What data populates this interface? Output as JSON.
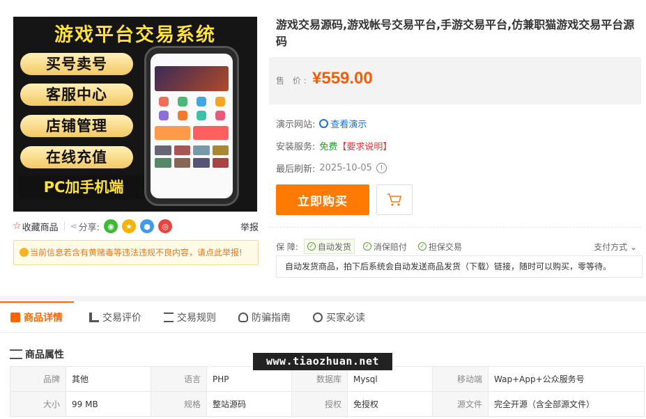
{
  "product_image": {
    "headline": "游戏平台交易系统",
    "pills": [
      "买号卖号",
      "客服中心",
      "店铺管理",
      "在线充值"
    ],
    "footer": "PC加手机端"
  },
  "share": {
    "favorite_label": "收藏商品",
    "share_label": "分享:",
    "icons": [
      "wechat-icon",
      "qzone-icon",
      "qq-icon",
      "weibo-icon"
    ],
    "report_label": "举报"
  },
  "warning": "当前信息若含有黄赌毒等违法违规不良内容，请点此举报!",
  "product": {
    "title": "游戏交易源码,游戏帐号交易平台,手游交易平台,仿兼职猫游戏交易平台源码",
    "price_label": "售  价:",
    "price": "¥559.00",
    "demo_label": "演示网站:",
    "demo_link": "查看演示",
    "install_label": "安装服务:",
    "install_value": "免费",
    "install_note": "【要求说明】",
    "refresh_label": "最后刷新:",
    "refresh_date": "2025-10-05"
  },
  "buttons": {
    "buy": "立即购买"
  },
  "guarantee": {
    "label": "保  障:",
    "tags": [
      "自动发货",
      "消保赔付",
      "担保交易"
    ],
    "payway": "支付方式",
    "description": "自动发货商品，拍下后系统会自动发送商品发货（下载）链接，随时可以购买，零等待。"
  },
  "tabs": [
    "商品详情",
    "交易评价",
    "交易规则",
    "防骗指南",
    "买家必读"
  ],
  "attributes": {
    "title": "商品属性",
    "rows": [
      [
        [
          "品牌",
          "其他"
        ],
        [
          "语言",
          "PHP"
        ],
        [
          "数据库",
          "Mysql"
        ],
        [
          "移动端",
          "Wap+App+公众服务号"
        ]
      ],
      [
        [
          "大小",
          "99 MB"
        ],
        [
          "规格",
          "整站源码"
        ],
        [
          "授权",
          "免授权"
        ],
        [
          "源文件",
          "完全开源（含全部源文件）"
        ]
      ]
    ]
  },
  "watermark": "www.tiaozhuan.net",
  "colors": {
    "accent": "#ff7a00",
    "price": "#ff5a00",
    "link": "#1e6fd9",
    "free": "#19a317",
    "alert": "#e4393c"
  }
}
